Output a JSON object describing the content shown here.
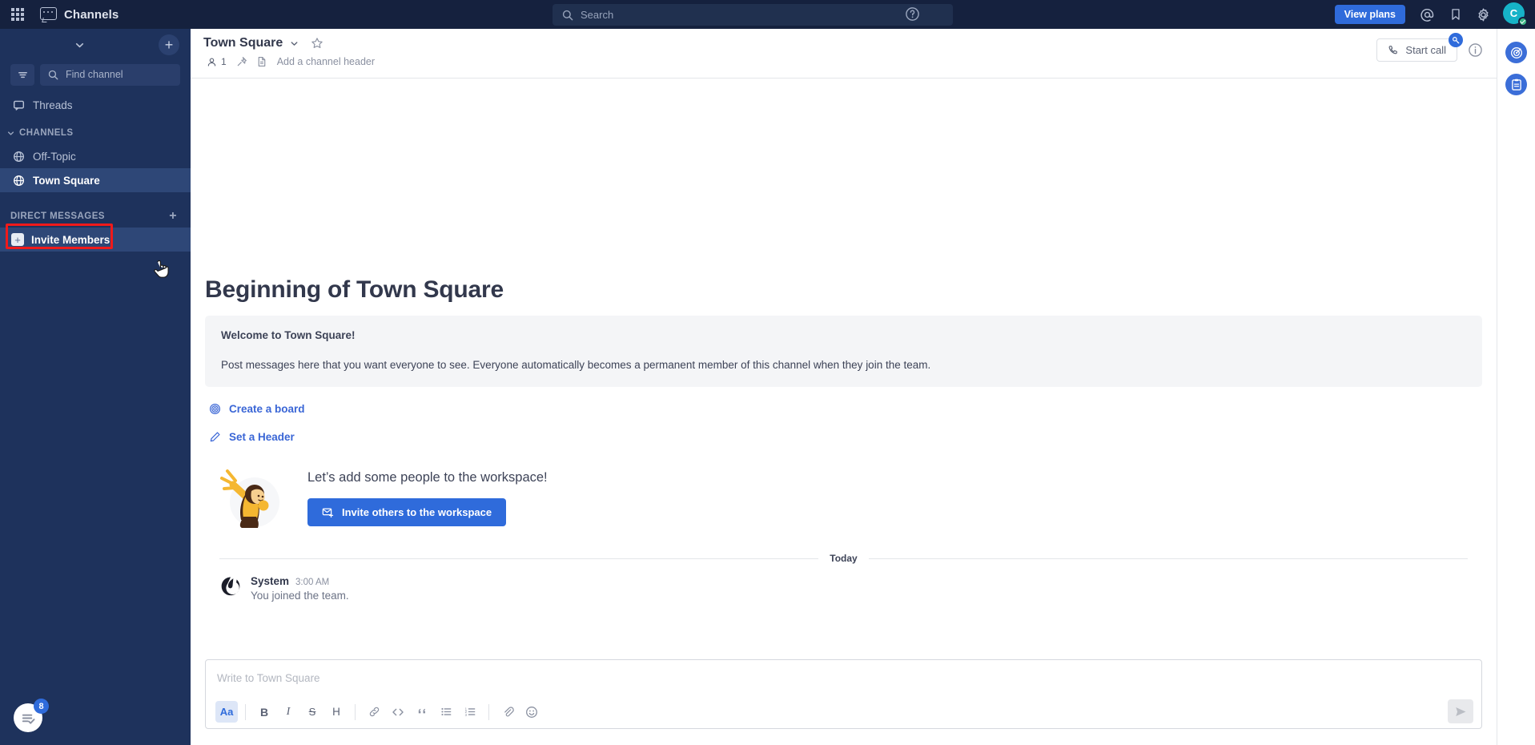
{
  "global_header": {
    "product_name": "Channels",
    "search_placeholder": "Search",
    "view_plans_label": "View plans",
    "avatar_initial": "C",
    "icons": {
      "grid": "product-switcher-icon",
      "help": "help-icon",
      "mentions": "at-mention-icon",
      "saved": "bookmark-icon",
      "settings": "gear-icon"
    }
  },
  "sidebar": {
    "find_channel_placeholder": "Find channel",
    "threads_label": "Threads",
    "categories": [
      {
        "name": "CHANNELS",
        "items": [
          {
            "label": "Off-Topic",
            "icon": "globe-icon",
            "active": false
          },
          {
            "label": "Town Square",
            "icon": "globe-icon",
            "active": true
          }
        ]
      },
      {
        "name": "DIRECT MESSAGES",
        "items": [
          {
            "label": "Invite Members",
            "icon": "plus-box-icon",
            "active": true
          }
        ]
      }
    ],
    "bottom_button": {
      "name": "onboarding-checklist",
      "badge": "8"
    }
  },
  "channel_header": {
    "title": "Town Square",
    "member_count": "1",
    "header_placeholder": "Add a channel header",
    "start_call_label": "Start call"
  },
  "right_rail": {
    "items": [
      {
        "name": "playbooks-icon"
      },
      {
        "name": "boards-icon"
      }
    ]
  },
  "main": {
    "intro_title": "Beginning of Town Square",
    "welcome_strong": "Welcome to Town Square!",
    "welcome_body": "Post messages here that you want everyone to see. Everyone automatically becomes a permanent member of this channel when they join the team.",
    "actions": [
      {
        "label": "Create a board",
        "icon": "board-icon"
      },
      {
        "label": "Set a Header",
        "icon": "pencil-icon"
      }
    ],
    "invite_heading": "Let’s add some people to the workspace!",
    "invite_button_label": "Invite others to the workspace",
    "date_divider": "Today",
    "posts": [
      {
        "author": "System",
        "time": "3:00 AM",
        "body": "You joined the team.",
        "avatar": "mattermost-logo"
      }
    ]
  },
  "composer": {
    "placeholder": "Write to Town Square",
    "toolbar": [
      {
        "name": "formatting-toggle",
        "glyph": "Aa",
        "active": true
      },
      {
        "name": "bold-button",
        "glyph": "B",
        "active": false
      },
      {
        "name": "italic-button",
        "glyph": "I",
        "active": false
      },
      {
        "name": "strikethrough-button",
        "glyph": "S",
        "active": false
      },
      {
        "name": "heading-button",
        "glyph": "H",
        "active": false
      },
      {
        "name": "link-button",
        "glyph": "link",
        "active": false
      },
      {
        "name": "code-button",
        "glyph": "code",
        "active": false
      },
      {
        "name": "quote-button",
        "glyph": "quote",
        "active": false
      },
      {
        "name": "bullet-list-button",
        "glyph": "ul",
        "active": false
      },
      {
        "name": "ordered-list-button",
        "glyph": "ol",
        "active": false
      },
      {
        "name": "attachment-button",
        "glyph": "paperclip",
        "active": false
      },
      {
        "name": "emoji-button",
        "glyph": "smiley",
        "active": false
      }
    ],
    "send_label": "send-icon"
  },
  "colors": {
    "header_bg": "#15213e",
    "sidebar_bg": "#1e325c",
    "sidebar_active": "#2e4777",
    "accent_blue": "#2f6bdb",
    "highlight_red": "#f01a1a",
    "online_green": "#3db887",
    "avatar_teal": "#16b3c8"
  }
}
